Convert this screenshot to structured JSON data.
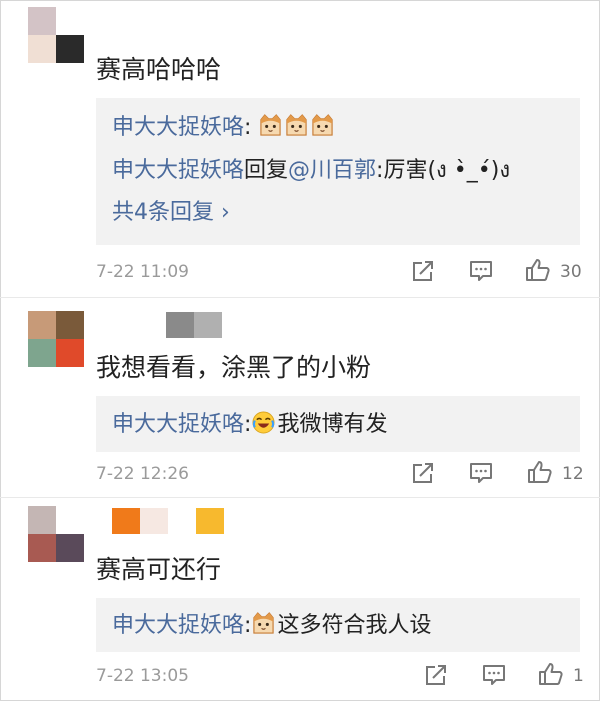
{
  "comments": [
    {
      "text": "赛高哈哈哈",
      "reply_lines": [
        {
          "user": "申大大捉妖咯",
          "sep": ":",
          "emojis": [
            "cat-face",
            "cat-face",
            "cat-face"
          ],
          "body": ""
        },
        {
          "user": "申大大捉妖咯",
          "mid": "回复",
          "mention": "@川百郭",
          "body": ":厉害(ง •̀_•́)ง"
        }
      ],
      "more_replies": "共4条回复 ›",
      "time": "7-22 11:09",
      "likes": "30"
    },
    {
      "text": "我想看看，涂黑了的小粉",
      "reply_lines": [
        {
          "user": "申大大捉妖咯",
          "sep": ":",
          "emojis": [
            "laughing-tears-face"
          ],
          "body": "我微博有发"
        }
      ],
      "time": "7-22 12:26",
      "likes": "12"
    },
    {
      "text": "赛高可还行",
      "reply_lines": [
        {
          "user": "申大大捉妖咯",
          "sep": ":",
          "emojis": [
            "cat-face"
          ],
          "body": "这多符合我人设"
        }
      ],
      "time": "7-22 13:05",
      "likes": "1"
    }
  ],
  "icons": {
    "share": "share-icon",
    "comment": "comment-icon",
    "like": "thumbs-up-icon"
  },
  "colors": {
    "username": "#4a6a9c",
    "reply_bg": "#f2f2f2",
    "meta": "#9a9a9a"
  }
}
